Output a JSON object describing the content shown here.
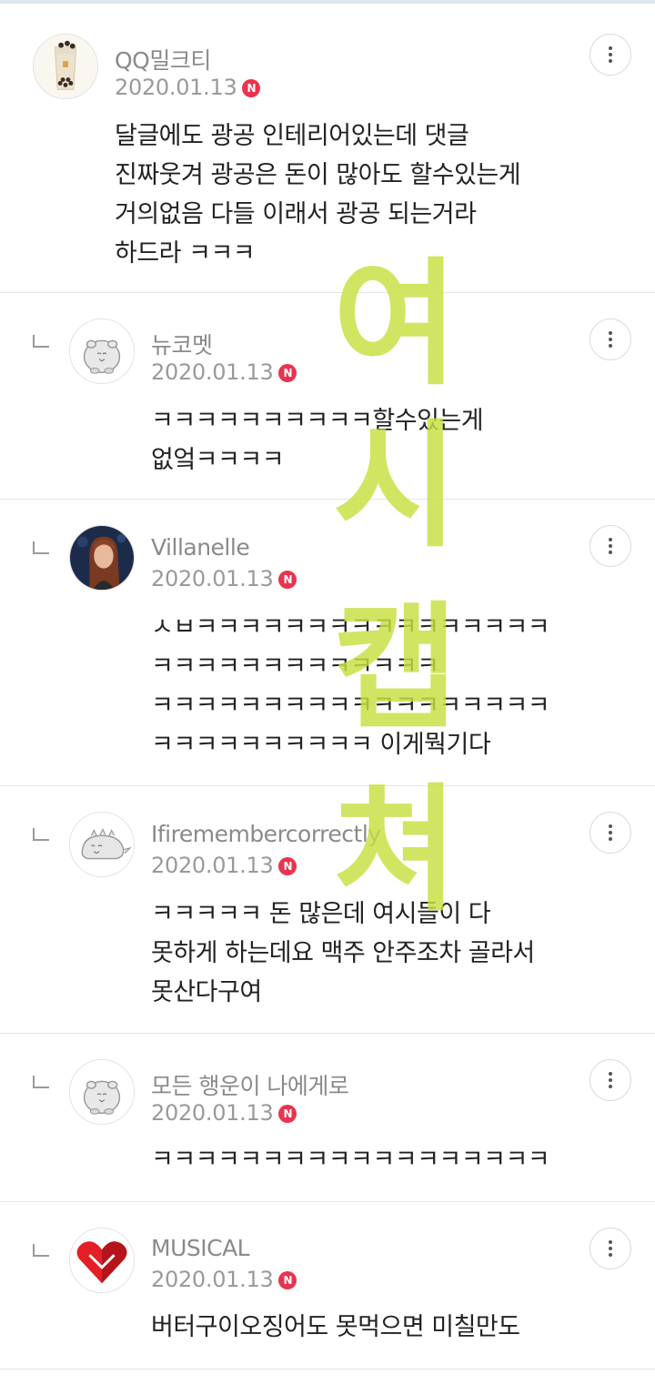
{
  "comments": [
    {
      "nickname": "QQ밀크티",
      "date": "2020.01.13",
      "badge": "N",
      "lines": [
        "달글에도 광공 인테리어있는데 댓글",
        "진짜웃겨 광공은 돈이 많아도 할수있는게",
        "거의없음 다들 이래서 광공 되는거라",
        "하드라 ㅋㅋㅋ"
      ],
      "avatar": "bubble-tea-avatar"
    },
    {
      "nickname": "뉴코멧",
      "date": "2020.01.13",
      "badge": "N",
      "lines": [
        "ㅋㅋㅋㅋㅋㅋㅋㅋㅋㅋ할수있는게",
        "없엌ㅋㅋㅋㅋ"
      ],
      "avatar": "default-hamster-avatar"
    },
    {
      "nickname": "Villanelle",
      "date": "2020.01.13",
      "badge": "N",
      "lines": [
        "ㅅㅂㅋㅋㅋㅋㅋㅋㅋㅋㅋㅋㅋㅋㅋㅋㅋㅋ",
        "ㅋㅋㅋㅋㅋㅋㅋㅋㅋㅋㅋㅋㅋ",
        "ㅋㅋㅋㅋㅋㅋㅋㅋㅋㅋㅋㅋㅋㅋㅋㅋㅋㅋ",
        "ㅋㅋㅋㅋㅋㅋㅋㅋㅋㅋ 이게뭑기다"
      ],
      "avatar": "photo-avatar"
    },
    {
      "nickname": "Ifiremembercorrectly",
      "date": "2020.01.13",
      "badge": "N",
      "lines": [
        "ㅋㅋㅋㅋㅋ 돈 많은데 여시들이 다",
        "못하게 하는데요 맥주 안주조차 골라서",
        "못산다구여"
      ],
      "avatar": "dinosaur-avatar"
    },
    {
      "nickname": "모든 행운이 나에게로",
      "date": "2020.01.13",
      "badge": "N",
      "lines": [
        "ㅋㅋㅋㅋㅋㅋㅋㅋㅋㅋㅋㅋㅋㅋㅋㅋㅋㅋ"
      ],
      "avatar": "default-hamster-avatar"
    },
    {
      "nickname": "MUSICAL",
      "date": "2020.01.13",
      "badge": "N",
      "lines": [
        "버터구이오징어도 못먹으면 미칠만도"
      ],
      "avatar": "red-heart-avatar"
    }
  ],
  "watermark": {
    "chars": [
      "여",
      "시",
      "캡",
      "쳐"
    ],
    "color": "#c8e040"
  },
  "colors": {
    "badge": "#e8344e",
    "nickname": "#8a8a8a",
    "divider": "#e6e6e6"
  }
}
